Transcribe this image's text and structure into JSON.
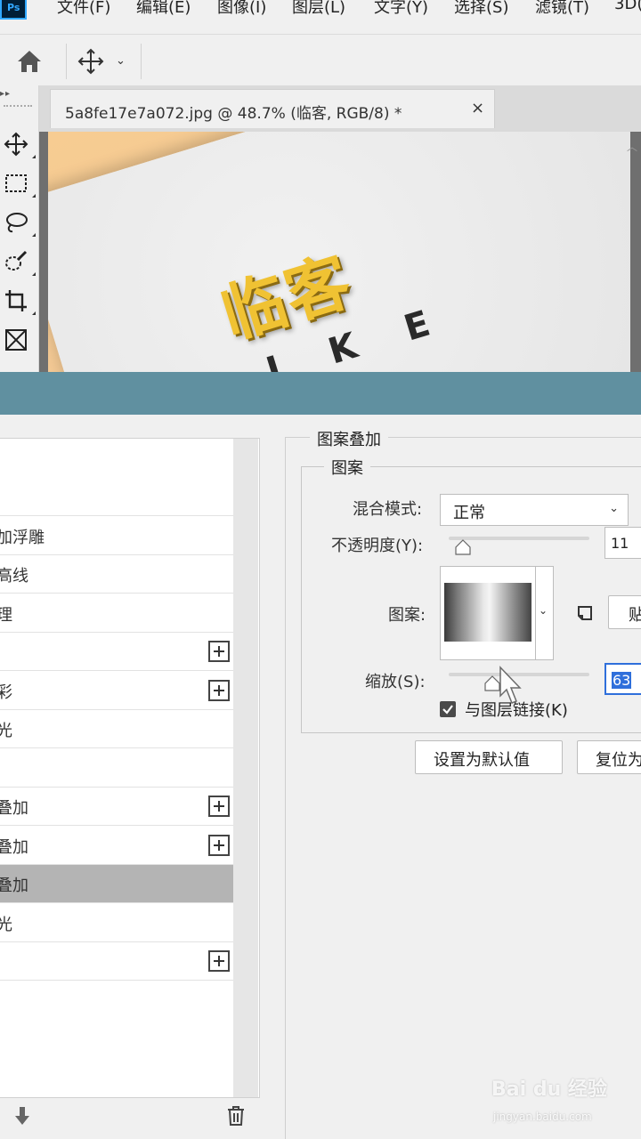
{
  "menubar": {
    "app_icon": "Ps",
    "items": [
      "文件(F)",
      "编辑(E)",
      "图像(I)",
      "图层(L)",
      "文字(Y)",
      "选择(S)",
      "滤镜(T)",
      "3D("
    ]
  },
  "options_bar": {
    "home_icon": "home-icon",
    "tool_icon": "move-icon",
    "dropdown": "⌄"
  },
  "document": {
    "tab_title": "5a8fe17e7a072.jpg @ 48.7% (临客, RGB/8) *",
    "close": "×",
    "canvas_logo_cn": "临客",
    "canvas_logo_en": "I K E"
  },
  "tools": [
    "move-tool",
    "marquee-tool",
    "lasso-tool",
    "quick-select-tool",
    "crop-tool",
    "frame-tool"
  ],
  "dialog": {
    "style_list": [
      {
        "label": "",
        "plus": false,
        "selected": false
      },
      {
        "label": "加浮雕",
        "plus": false,
        "selected": false
      },
      {
        "label": "高线",
        "plus": false,
        "selected": false
      },
      {
        "label": "理",
        "plus": false,
        "selected": false
      },
      {
        "label": "",
        "plus": true,
        "selected": false
      },
      {
        "label": "彩",
        "plus": true,
        "selected": false
      },
      {
        "label": "光",
        "plus": false,
        "selected": false
      },
      {
        "label": "",
        "plus": false,
        "selected": false
      },
      {
        "label": "叠加",
        "plus": true,
        "selected": false
      },
      {
        "label": "叠加",
        "plus": true,
        "selected": false
      },
      {
        "label": "叠加",
        "plus": false,
        "selected": true
      },
      {
        "label": "光",
        "plus": false,
        "selected": false
      },
      {
        "label": "",
        "plus": true,
        "selected": false
      }
    ],
    "section_title": "图案叠加",
    "group_title": "图案",
    "blend_mode_label": "混合模式:",
    "blend_mode_value": "正常",
    "opacity_label": "不透明度(Y):",
    "opacity_value": "11",
    "pattern_label": "图案:",
    "snap_button": "贴",
    "scale_label": "缩放(S):",
    "scale_value": "63",
    "link_label": "与图层链接(K)",
    "link_checked": true,
    "default_button": "设置为默认值",
    "reset_button": "复位为"
  },
  "watermark": {
    "main": "Bai du 经验",
    "sub": "jingyan.baidu.com"
  }
}
